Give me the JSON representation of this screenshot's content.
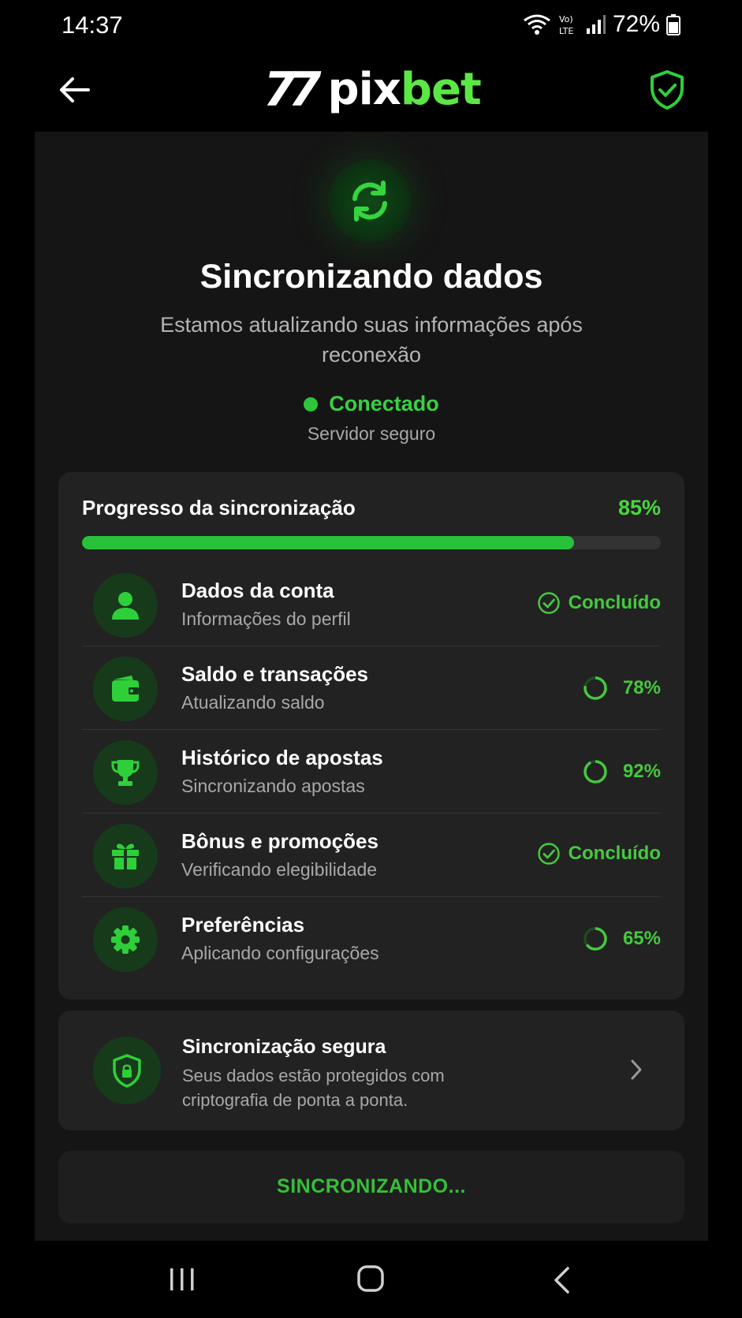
{
  "status_bar": {
    "time": "14:37",
    "network_label": "Vo) LTE",
    "battery": "72%",
    "icons": [
      "wifi-icon",
      "volte-icon",
      "signal-icon",
      "battery-icon"
    ]
  },
  "header": {
    "logo_number": "77",
    "logo_word_white": "pix",
    "logo_word_green": "bet",
    "back_icon": "arrow-left-icon",
    "shield_icon": "shield-check-icon"
  },
  "main": {
    "sync_icon": "sync-icon",
    "title": "Sincronizando dados",
    "subtitle": "Estamos atualizando suas informações após reconexão",
    "connection": {
      "status": "Conectado",
      "detail": "Servidor seguro"
    },
    "progress": {
      "label": "Progresso da sincronização",
      "percent_text": "85%",
      "value": 0.85
    },
    "items": [
      {
        "title": "Dados da conta",
        "subtitle": "Informações do perfil",
        "status": "Concluído",
        "icon": "user-icon",
        "done": true
      },
      {
        "title": "Saldo e transações",
        "subtitle": "Atualizando saldo",
        "status": "78%",
        "icon": "wallet-icon",
        "done": false,
        "value": 0.78
      },
      {
        "title": "Histórico de apostas",
        "subtitle": "Sincronizando apostas",
        "status": "92%",
        "icon": "trophy-icon",
        "done": false,
        "value": 0.92
      },
      {
        "title": "Bônus e promoções",
        "subtitle": "Verificando elegibilidade",
        "status": "Concluído",
        "icon": "gift-icon",
        "done": true
      },
      {
        "title": "Preferências",
        "subtitle": "Aplicando configurações",
        "status": "65%",
        "icon": "gear-icon",
        "done": false,
        "value": 0.65
      }
    ],
    "secure": {
      "title": "Sincronização segura",
      "description": "Seus dados estão protegidos com criptografia de ponta a ponta.",
      "icon": "shield-lock-icon"
    },
    "button_label": "SINCRONIZANDO..."
  },
  "colors": {
    "accent": "#2fcf3a",
    "background": "#000000",
    "panel": "#151515",
    "card": "#222222"
  }
}
